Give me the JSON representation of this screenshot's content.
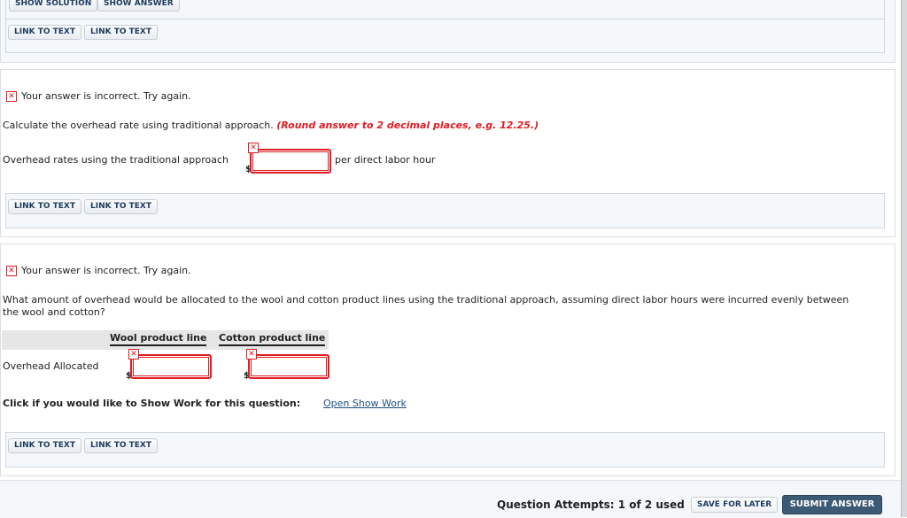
{
  "top_panel": {
    "buttons": [
      "SHOW SOLUTION",
      "SHOW ANSWER"
    ],
    "links": [
      "LINK TO TEXT",
      "LINK TO TEXT"
    ]
  },
  "part1": {
    "feedback": "Your answer is incorrect.  Try again.",
    "question": "Calculate the overhead rate using traditional approach.",
    "hint": "(Round answer to 2 decimal places, e.g. 12.25.)",
    "row_label": "Overhead rates using the traditional approach",
    "currency": "$",
    "input_value": "",
    "unit": "per direct labor hour",
    "links": [
      "LINK TO TEXT",
      "LINK TO TEXT"
    ]
  },
  "part2": {
    "feedback": "Your answer is incorrect.  Try again.",
    "question_line1": "What amount of overhead would be allocated to the wool and cotton product lines using the traditional approach, assuming direct labor hours were incurred evenly between",
    "question_line2": "the wool and cotton?",
    "table": {
      "columns": [
        "Wool product line",
        "Cotton product line"
      ],
      "rows": [
        {
          "label": "Overhead Allocated",
          "currency": "$",
          "values": [
            "",
            ""
          ]
        }
      ]
    },
    "show_work_prompt": "Click if you would like to Show Work for this question:",
    "show_work_link": "Open Show Work",
    "links": [
      "LINK TO TEXT",
      "LINK TO TEXT"
    ]
  },
  "footer": {
    "attempts": "Question Attempts: 1 of 2 used",
    "save_label": "SAVE FOR LATER",
    "submit_label": "SUBMIT ANSWER"
  },
  "colors": {
    "error": "#e01b22",
    "submit_bg": "#3c5a74",
    "link": "#1f4f8c"
  }
}
